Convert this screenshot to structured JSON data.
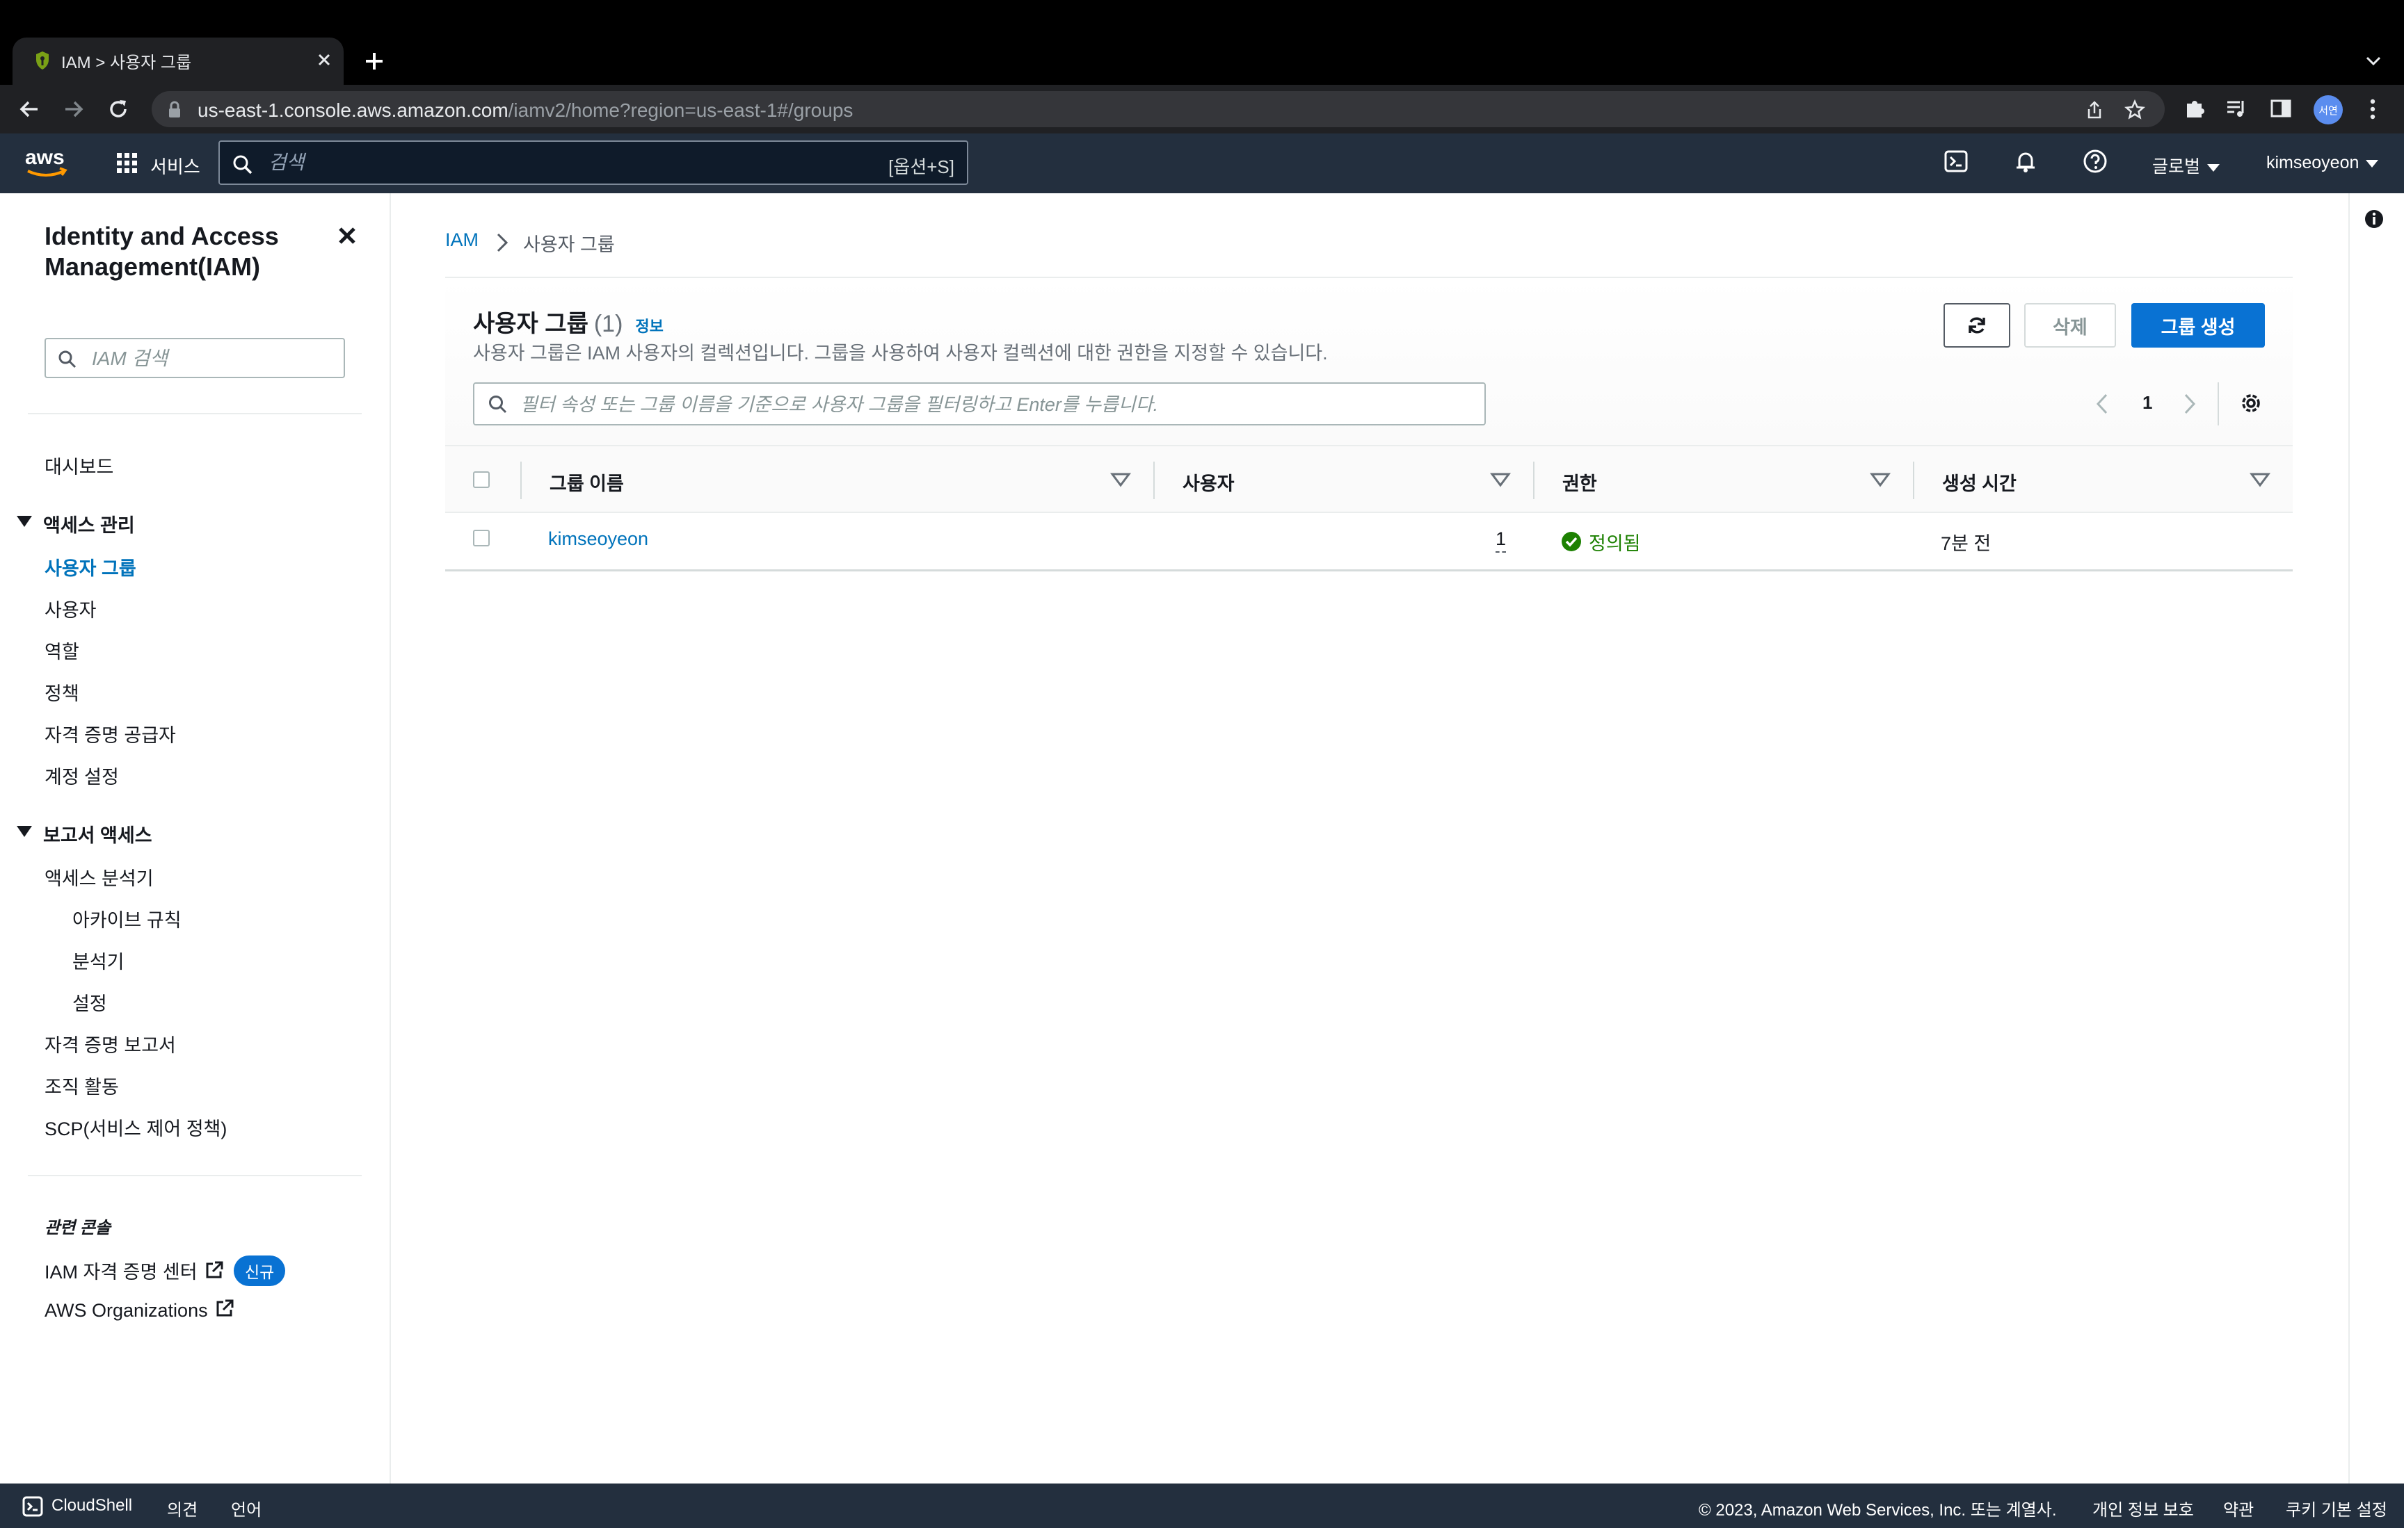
{
  "browser": {
    "tab_title": "IAM > 사용자 그룹",
    "url_host": "us-east-1.console.aws.amazon.com",
    "url_path": "/iamv2/home?region=us-east-1#/groups",
    "profile_initials": "서연"
  },
  "aws_nav": {
    "logo_text": "aws",
    "services_label": "서비스",
    "search_placeholder": "검색",
    "search_shortcut": "[옵션+S]",
    "region_label": "글로벌",
    "user_label": "kimseoyeon"
  },
  "sidebar": {
    "title": "Identity and Access Management(IAM)",
    "search_placeholder": "IAM 검색",
    "dashboard": "대시보드",
    "access_mgmt": {
      "heading": "액세스 관리",
      "items": [
        "사용자 그룹",
        "사용자",
        "역할",
        "정책",
        "자격 증명 공급자",
        "계정 설정"
      ]
    },
    "report_access": {
      "heading": "보고서 액세스",
      "analyzer": "액세스 분석기",
      "analyzer_sub": [
        "아카이브 규칙",
        "분석기",
        "설정"
      ],
      "items": [
        "자격 증명 보고서",
        "조직 활동",
        "SCP(서비스 제어 정책)"
      ]
    },
    "related_heading": "관련 콘솔",
    "related": [
      "IAM 자격 증명 센터",
      "AWS Organizations"
    ],
    "new_badge": "신규"
  },
  "breadcrumb": {
    "root": "IAM",
    "current": "사용자 그룹"
  },
  "panel": {
    "title": "사용자 그룹",
    "count": "(1)",
    "info": "정보",
    "description": "사용자 그룹은 IAM 사용자의 컬렉션입니다. 그룹을 사용하여 사용자 컬렉션에 대한 권한을 지정할 수 있습니다.",
    "delete_label": "삭제",
    "create_label": "그룹 생성",
    "filter_placeholder": "필터 속성 또는 그룹 이름을 기준으로 사용자 그룹을 필터링하고 Enter를 누릅니다.",
    "page": "1"
  },
  "table": {
    "columns": [
      "그룹 이름",
      "사용자",
      "권한",
      "생성 시간"
    ],
    "rows": [
      {
        "name": "kimseoyeon",
        "users": "1",
        "permissions": "정의됨",
        "created": "7분 전"
      }
    ]
  },
  "footer": {
    "cloudshell": "CloudShell",
    "feedback": "의견",
    "language": "언어",
    "copyright": "© 2023, Amazon Web Services, Inc. 또는 계열사.",
    "privacy": "개인 정보 보호",
    "terms": "약관",
    "cookies": "쿠키 기본 설정"
  },
  "colors": {
    "aws_nav_bg": "#232f3e",
    "link": "#0073bb",
    "primary_button": "#0972d3",
    "success": "#1d8102"
  }
}
